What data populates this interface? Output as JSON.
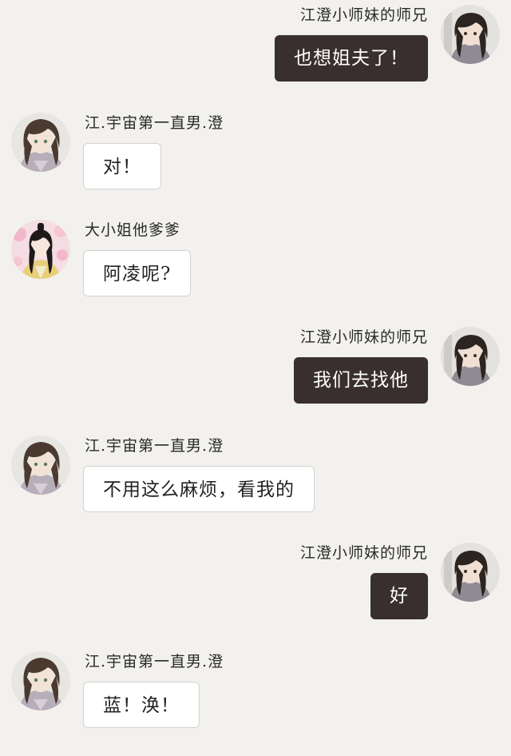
{
  "conversation": {
    "messages": [
      {
        "sender": "江澄小师妹的师兄",
        "text": "也想姐夫了！",
        "direction": "outgoing",
        "avatar": "dark-haired-man-avatar"
      },
      {
        "sender": "江.宇宙第一直男.澄",
        "text": "对！",
        "direction": "incoming",
        "avatar": "anime-man-avatar"
      },
      {
        "sender": "大小姐他爹爹",
        "text": "阿凌呢?",
        "direction": "incoming",
        "avatar": "anime-man-pink-flowers-avatar"
      },
      {
        "sender": "江澄小师妹的师兄",
        "text": "我们去找他",
        "direction": "outgoing",
        "avatar": "dark-haired-man-avatar"
      },
      {
        "sender": "江.宇宙第一直男.澄",
        "text": "不用这么麻烦，看我的",
        "direction": "incoming",
        "avatar": "anime-man-avatar"
      },
      {
        "sender": "江澄小师妹的师兄",
        "text": "好",
        "direction": "outgoing",
        "avatar": "dark-haired-man-avatar"
      },
      {
        "sender": "江.宇宙第一直男.澄",
        "text": "蓝！涣！",
        "direction": "incoming",
        "avatar": "anime-man-avatar"
      }
    ]
  },
  "colors": {
    "background": "#f2f1ed",
    "outgoing_bubble": "#3a2f2f",
    "incoming_bubble": "#ffffff"
  }
}
